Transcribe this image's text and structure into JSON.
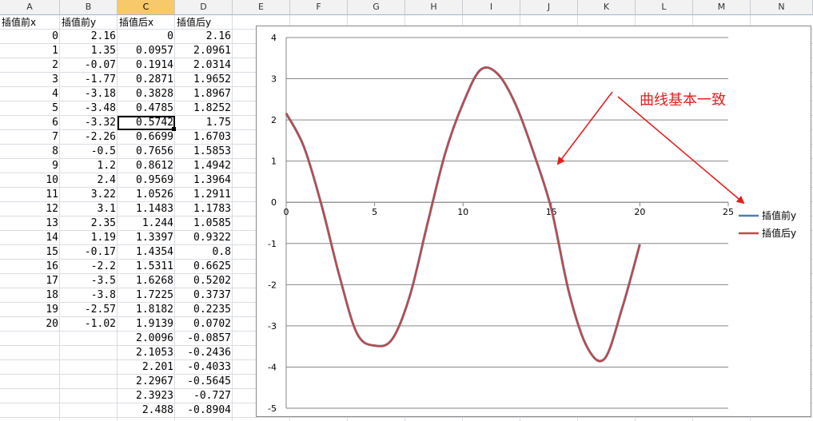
{
  "columns": [
    "A",
    "B",
    "C",
    "D",
    "E",
    "F",
    "G",
    "H",
    "I",
    "J",
    "K",
    "L",
    "M",
    "N"
  ],
  "selected_column": "C",
  "headers": {
    "a": "插值前x",
    "b": "插值前y",
    "c": "插值后x",
    "d": "插值后y"
  },
  "before": {
    "x": [
      "0",
      "1",
      "2",
      "3",
      "4",
      "5",
      "6",
      "7",
      "8",
      "9",
      "10",
      "11",
      "12",
      "13",
      "14",
      "15",
      "16",
      "17",
      "18",
      "19",
      "20"
    ],
    "y": [
      "2.16",
      "1.35",
      "-0.07",
      "-1.77",
      "-3.18",
      "-3.48",
      "-3.32",
      "-2.26",
      "-0.5",
      "1.2",
      "2.4",
      "3.22",
      "3.1",
      "2.35",
      "1.19",
      "-0.17",
      "-2.2",
      "-3.5",
      "-3.8",
      "-2.57",
      "-1.02"
    ]
  },
  "after": {
    "x": [
      "0",
      "0.0957",
      "0.1914",
      "0.2871",
      "0.3828",
      "0.4785",
      "0.5742",
      "0.6699",
      "0.7656",
      "0.8612",
      "0.9569",
      "1.0526",
      "1.1483",
      "1.244",
      "1.3397",
      "1.4354",
      "1.5311",
      "1.6268",
      "1.7225",
      "1.8182",
      "1.9139",
      "2.0096",
      "2.1053",
      "2.201",
      "2.2967",
      "2.3923",
      "2.488"
    ],
    "y": [
      "2.16",
      "2.0961",
      "2.0314",
      "1.9652",
      "1.8967",
      "1.8252",
      "1.75",
      "1.6703",
      "1.5853",
      "1.4942",
      "1.3964",
      "1.2911",
      "1.1783",
      "1.0585",
      "0.9322",
      "0.8",
      "0.6625",
      "0.5202",
      "0.3737",
      "0.2235",
      "0.0702",
      "-0.0857",
      "-0.2436",
      "-0.4033",
      "-0.5645",
      "-0.727",
      "-0.8904"
    ]
  },
  "active_cell": "C8",
  "chart_data": {
    "type": "line",
    "xlim": [
      0,
      25
    ],
    "ylim": [
      -5,
      4
    ],
    "x_ticks": [
      "0",
      "5",
      "10",
      "15",
      "20",
      "25"
    ],
    "y_ticks": [
      "4",
      "3",
      "2",
      "1",
      "0",
      "-1",
      "-2",
      "-3",
      "-4",
      "-5"
    ],
    "grid": true,
    "legend_position": "right",
    "series": [
      {
        "name": "插值前y",
        "color": "#4a7ebb",
        "x": [
          0,
          1,
          2,
          3,
          4,
          5,
          6,
          7,
          8,
          9,
          10,
          11,
          12,
          13,
          14,
          15,
          16,
          17,
          18,
          19,
          20
        ],
        "y": [
          2.16,
          1.35,
          -0.07,
          -1.77,
          -3.18,
          -3.48,
          -3.32,
          -2.26,
          -0.5,
          1.2,
          2.4,
          3.22,
          3.1,
          2.35,
          1.19,
          -0.17,
          -2.2,
          -3.5,
          -3.8,
          -2.57,
          -1.02
        ]
      },
      {
        "name": "插值后y",
        "color": "#be4b48",
        "x": [
          0,
          1,
          2,
          3,
          4,
          5,
          6,
          7,
          8,
          9,
          10,
          11,
          12,
          13,
          14,
          15,
          16,
          17,
          18,
          19,
          20
        ],
        "y": [
          2.16,
          1.35,
          -0.07,
          -1.77,
          -3.18,
          -3.48,
          -3.32,
          -2.26,
          -0.5,
          1.2,
          2.4,
          3.22,
          3.1,
          2.35,
          1.19,
          -0.17,
          -2.2,
          -3.5,
          -3.8,
          -2.57,
          -1.02
        ]
      }
    ],
    "annotation": "曲线基本一致",
    "annotation_color": "#e02020"
  }
}
